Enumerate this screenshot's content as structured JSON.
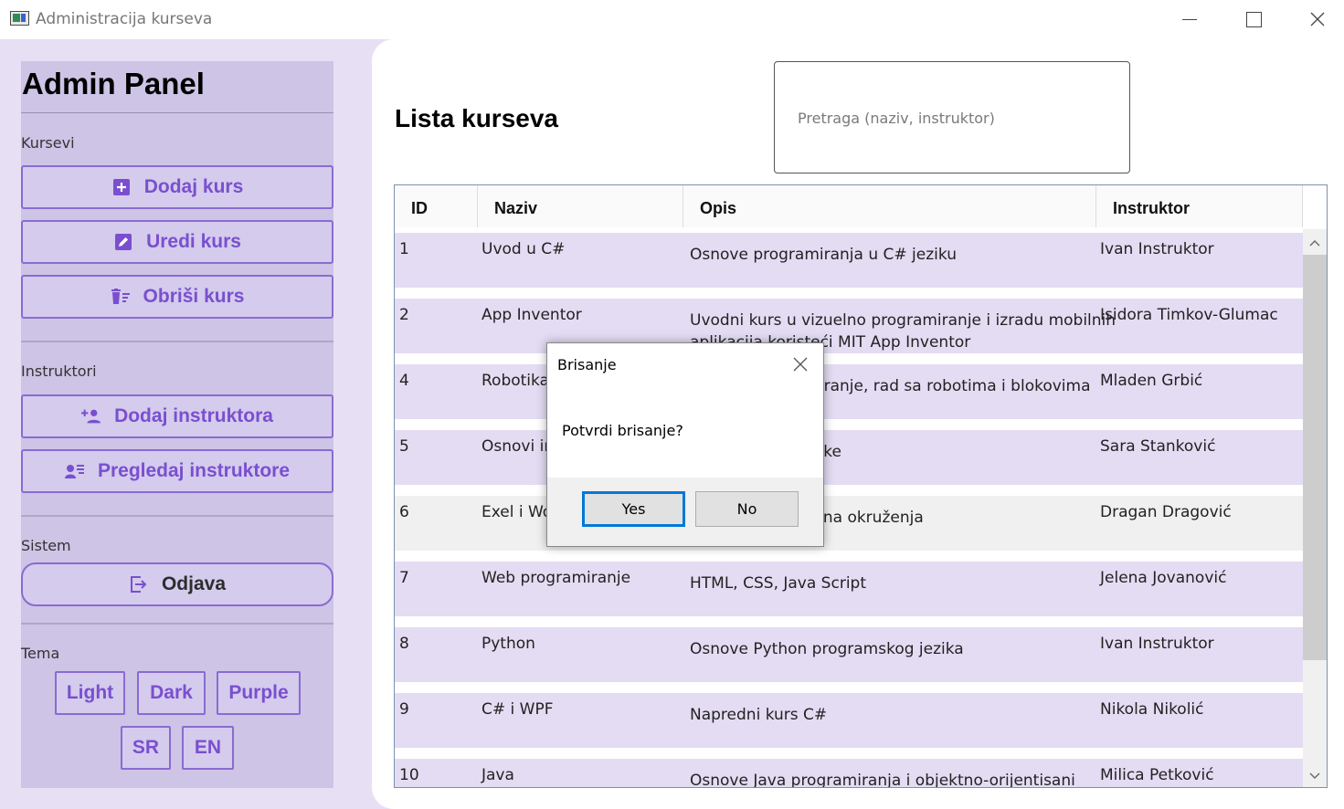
{
  "window": {
    "title": "Administracija kurseva"
  },
  "sidebar": {
    "title": "Admin Panel",
    "sections": {
      "courses": "Kursevi",
      "instructors": "Instruktori",
      "system": "Sistem",
      "theme": "Tema"
    },
    "buttons": {
      "add_course": "Dodaj kurs",
      "edit_course": "Uredi kurs",
      "delete_course": "Obriši kurs",
      "add_instructor": "Dodaj instruktora",
      "view_instructors": "Pregledaj instruktore",
      "logout": "Odjava"
    },
    "theme_buttons": {
      "light": "Light",
      "dark": "Dark",
      "purple": "Purple",
      "sr": "SR",
      "en": "EN"
    }
  },
  "main": {
    "title": "Lista kurseva",
    "search_placeholder": "Pretraga (naziv, instruktor)"
  },
  "table": {
    "headers": {
      "id": "ID",
      "name": "Naziv",
      "description": "Opis",
      "instructor": "Instruktor"
    },
    "rows": [
      {
        "id": "1",
        "name": "Uvod u C#",
        "desc1": "Osnove programiranja u C# jeziku",
        "desc2": "",
        "instructor": "Ivan Instruktor"
      },
      {
        "id": "2",
        "name": "App Inventor",
        "desc1": "Uvodni kurs u vizuelno programiranje i izradu mobilnih",
        "desc2": "aplikacija koristeći MIT App Inventor",
        "instructor": "Isidora Timkov-Glumac"
      },
      {
        "id": "4",
        "name": "Robotika",
        "desc1": "Osnove programiranje, rad sa robotima i blokovima",
        "desc2": "",
        "instructor": "Mladen Grbić"
      },
      {
        "id": "5",
        "name": "Osnovi informatike",
        "desc1": "Osnove informatike",
        "desc2": "",
        "instructor": "Sara Stanković"
      },
      {
        "id": "6",
        "name": "Exel i Word",
        "desc1": "Kancelarijska radna okruženja",
        "desc2": "",
        "instructor": "Dragan Dragović"
      },
      {
        "id": "7",
        "name": "Web programiranje",
        "desc1": "HTML, CSS, Java Script",
        "desc2": "",
        "instructor": "Jelena Jovanović"
      },
      {
        "id": "8",
        "name": "Python",
        "desc1": "Osnove Python programskog jezika",
        "desc2": "",
        "instructor": "Ivan Instruktor"
      },
      {
        "id": "9",
        "name": "C# i WPF",
        "desc1": "Napredni kurs C#",
        "desc2": "",
        "instructor": "Nikola Nikolić"
      },
      {
        "id": "10",
        "name": "Java",
        "desc1": "Osnove Java programiranja i objektno-orijentisani",
        "desc2": "",
        "instructor": "Milica Petković"
      }
    ]
  },
  "dialog": {
    "title": "Brisanje",
    "message": "Potvrdi brisanje?",
    "yes": "Yes",
    "no": "No"
  },
  "colors": {
    "accent": "#7a4fcf",
    "sidebar_bg": "#cdc4e6",
    "row_bg": "#e3dcf3"
  }
}
